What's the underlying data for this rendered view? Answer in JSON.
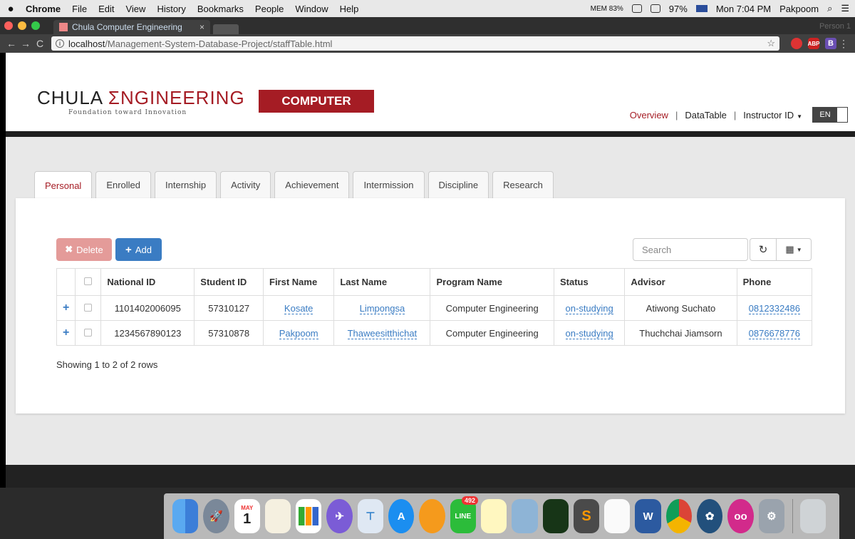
{
  "menubar": {
    "app": "Chrome",
    "items": [
      "File",
      "Edit",
      "View",
      "History",
      "Bookmarks",
      "People",
      "Window",
      "Help"
    ],
    "mem": "MEM 83%",
    "battery": "97%",
    "clock": "Mon 7:04 PM",
    "user": "Pakpoom"
  },
  "browser": {
    "tab_title": "Chula Computer Engineering",
    "tab_close": "×",
    "profile": "Person 1",
    "url_host": "localhost",
    "url_path": "/Management-System-Database-Project/staffTable.html",
    "ext_abp": "ABP",
    "ext_b": "B"
  },
  "site": {
    "logo_left": "CHULA ",
    "logo_right": "ΣNGINEERING",
    "tagline": "Foundation toward Innovation",
    "badge": "COMPUTER",
    "nav": {
      "overview": "Overview",
      "datatable": "DataTable",
      "instructor": "Instructor ID",
      "lang": "EN"
    }
  },
  "tabs": [
    "Personal",
    "Enrolled",
    "Internship",
    "Activity",
    "Achievement",
    "Intermission",
    "Discipline",
    "Research"
  ],
  "toolbar": {
    "delete_label": "Delete",
    "add_label": "Add",
    "search_placeholder": "Search"
  },
  "table": {
    "headers": [
      "National ID",
      "Student ID",
      "First Name",
      "Last Name",
      "Program Name",
      "Status",
      "Advisor",
      "Phone"
    ],
    "rows": [
      {
        "national_id": "1101402006095",
        "student_id": "57310127",
        "first_name": "Kosate",
        "last_name": "Limpongsa",
        "program": "Computer Engineering",
        "status": "on-studying",
        "advisor": "Atiwong Suchato",
        "phone": "0812332486"
      },
      {
        "national_id": "1234567890123",
        "student_id": "57310878",
        "first_name": "Pakpoom",
        "last_name": "Thaweesitthichat",
        "program": "Computer Engineering",
        "status": "on-studying",
        "advisor": "Thuchchai Jiamsorn",
        "phone": "0876678776"
      }
    ],
    "info": "Showing 1 to 2 of 2 rows"
  },
  "dock": {
    "calendar_month": "MAY",
    "calendar_day": "1",
    "line_badge": "492",
    "line_label": "LINE"
  },
  "colors": {
    "brand_red": "#a51c24",
    "primary_blue": "#3a7cc3",
    "delete_pink": "#e49b99"
  }
}
